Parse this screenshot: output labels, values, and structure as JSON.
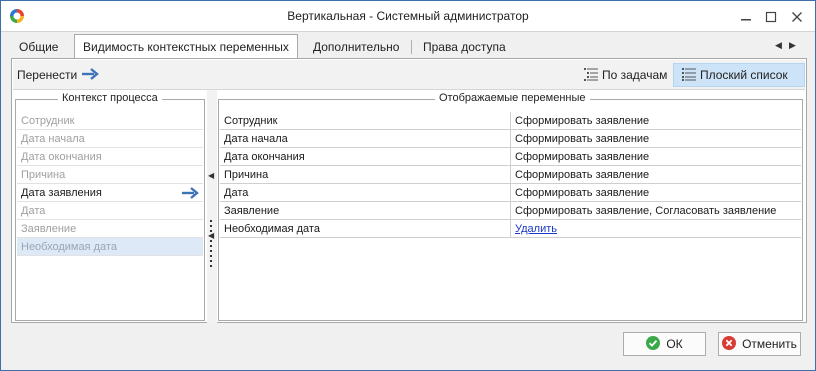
{
  "window": {
    "title": "Вертикальная - Системный администратор",
    "icon": "app-ring-icon",
    "controls": [
      "minimize-icon",
      "maximize-icon",
      "close-icon"
    ]
  },
  "tabs": [
    {
      "label": "Общие",
      "active": false
    },
    {
      "label": "Видимость контекстных переменных",
      "active": true
    },
    {
      "label": "Дополнительно",
      "active": false
    },
    {
      "label": "Права доступа",
      "active": false
    }
  ],
  "toolbar": {
    "transfer_label": "Перенести",
    "by_tasks_label": "По задачам",
    "flat_list_label": "Плоский список",
    "flat_list_selected": true
  },
  "left_panel": {
    "title": "Контекст процесса",
    "items": [
      {
        "label": "Сотрудник",
        "active": false
      },
      {
        "label": "Дата начала",
        "active": false
      },
      {
        "label": "Дата окончания",
        "active": false
      },
      {
        "label": "Причина",
        "active": false
      },
      {
        "label": "Дата заявления",
        "active": true
      },
      {
        "label": "Дата",
        "active": false
      },
      {
        "label": "Заявление",
        "active": false
      },
      {
        "label": "Необходимая дата",
        "active": false,
        "selected": true
      }
    ]
  },
  "right_panel": {
    "title": "Отображаемые переменные",
    "rows": [
      {
        "name": "Сотрудник",
        "tasks": "Сформировать заявление"
      },
      {
        "name": "Дата начала",
        "tasks": "Сформировать заявление"
      },
      {
        "name": "Дата окончания",
        "tasks": "Сформировать заявление"
      },
      {
        "name": "Причина",
        "tasks": "Сформировать заявление"
      },
      {
        "name": "Дата",
        "tasks": "Сформировать заявление"
      },
      {
        "name": "Заявление",
        "tasks": "Сформировать заявление, Согласовать заявление"
      },
      {
        "name": "Необходимая дата",
        "tasks": "Удалить",
        "is_link": true
      }
    ]
  },
  "footer": {
    "ok_label": "ОК",
    "cancel_label": "Отменить"
  },
  "colors": {
    "window_border": "#3c6ea8",
    "selected_toolbar": "#cde3f7",
    "selected_row": "#dde9f6",
    "arrow_blue": "#3f73b7",
    "link": "#1a38c6",
    "ok_green": "#3aa94a",
    "cancel_red": "#d93a32"
  }
}
